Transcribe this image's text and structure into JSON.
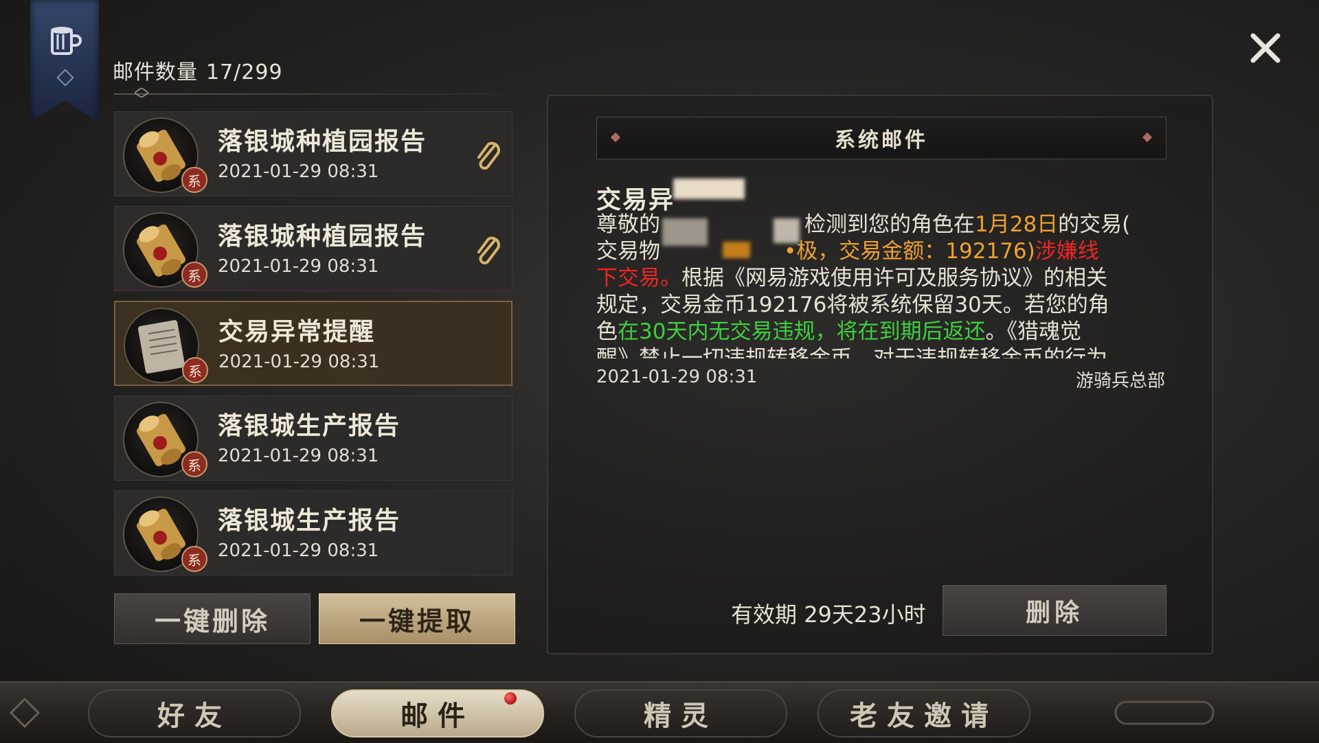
{
  "header": {
    "mail_count_label": "邮件数量",
    "mail_count_value": "17/299"
  },
  "mail_list": [
    {
      "title": "落银城种植园报告",
      "date": "2021-01-29 08:31",
      "icon": "scroll-icon",
      "badge": "系",
      "has_attachment": true
    },
    {
      "title": "落银城种植园报告",
      "date": "2021-01-29 08:31",
      "icon": "scroll-icon",
      "badge": "系",
      "has_attachment": true
    },
    {
      "title": "交易异常提醒",
      "date": "2021-01-29 08:31",
      "icon": "letter-icon",
      "badge": "系",
      "has_attachment": false,
      "selected": true
    },
    {
      "title": "落银城生产报告",
      "date": "2021-01-29 08:31",
      "icon": "scroll-icon",
      "badge": "系",
      "has_attachment": false
    },
    {
      "title": "落银城生产报告",
      "date": "2021-01-29 08:31",
      "icon": "scroll-icon",
      "badge": "系",
      "has_attachment": false
    }
  ],
  "list_actions": {
    "delete_all": "一键删除",
    "claim_all": "一键提取"
  },
  "detail": {
    "header_title": "系统邮件",
    "subject": "交易异",
    "body": {
      "p1_a": "尊敬的",
      "p1_b": "检测到您的角色在",
      "p1_date": "1月28日",
      "p1_c": "的交易(",
      "p2_a": "交易物",
      "p2_b": "•极，交易金额：",
      "p2_amount": "192176",
      "p2_c": ")",
      "p2_warn": "涉嫌线",
      "p3_warn": "下交易。",
      "p3_b": "根据《网易游戏使用许可及服务协议》的相关",
      "p4": "规定，交易金币192176将被系统保留30天。若您的角",
      "p5_a": "色",
      "p5_green": "在30天内无交易违规，将在到期后返还",
      "p5_b": "。《猎魂觉",
      "p6": "醒》禁止一切违规转移金币，对于违规转移金币的行为"
    },
    "date": "2021-01-29 08:31",
    "sender": "游骑兵总部",
    "validity_label": "有效期",
    "validity_value": "29天23小时",
    "delete_button": "删除"
  },
  "tabs": [
    {
      "label": "好友",
      "active": false
    },
    {
      "label": "邮件",
      "active": true,
      "notification": true
    },
    {
      "label": "精灵",
      "active": false
    },
    {
      "label": "老友邀请",
      "active": false
    }
  ],
  "colors": {
    "highlight_orange": "#f0a030",
    "warning_red": "#ee2626",
    "positive_green": "#3fcf3f",
    "selected_border": "#7a6240"
  }
}
